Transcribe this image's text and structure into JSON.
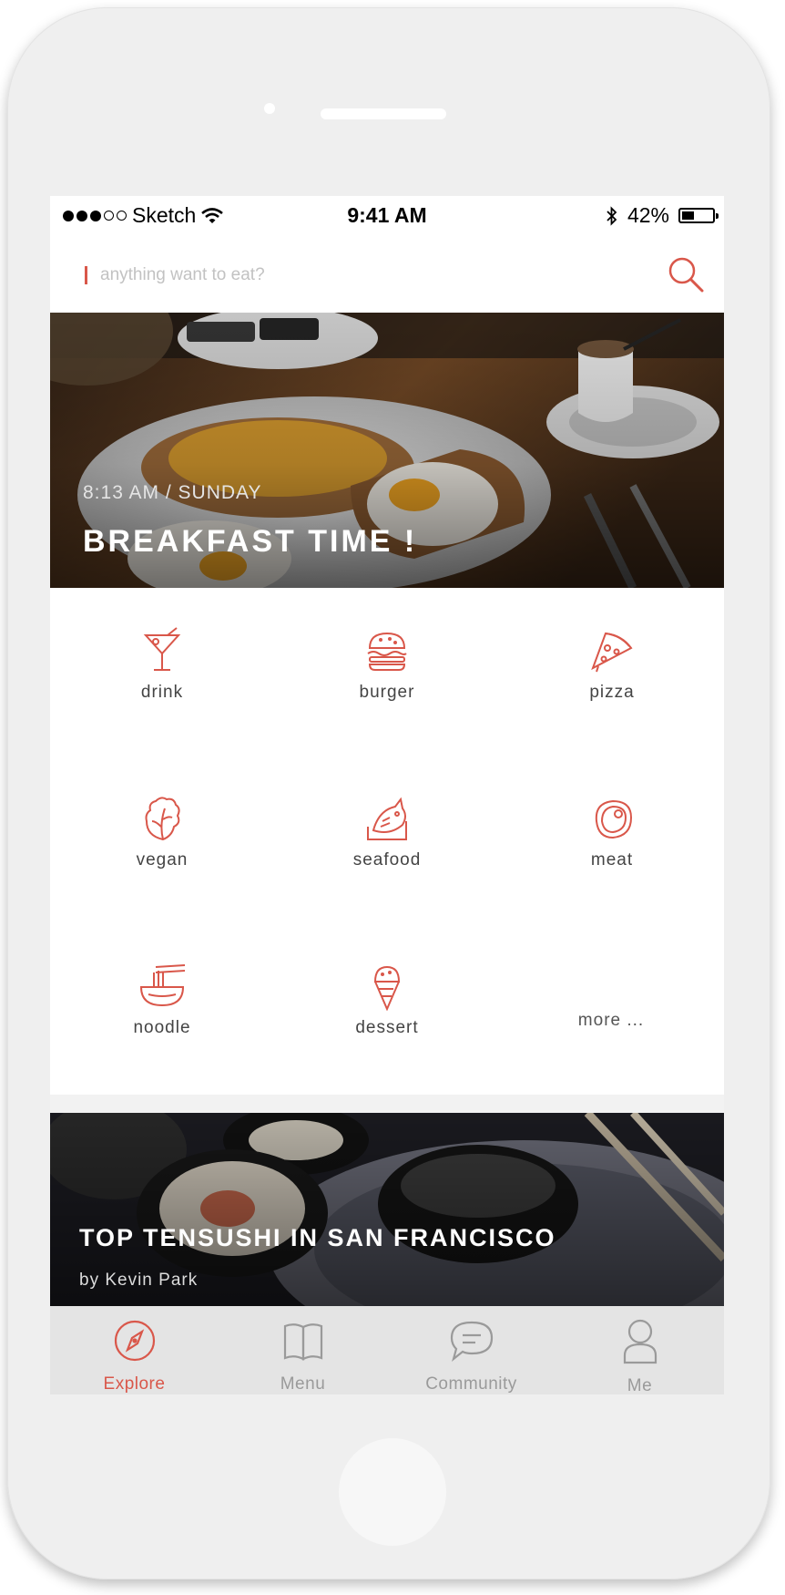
{
  "status_bar": {
    "carrier": "Sketch",
    "time": "9:41 AM",
    "battery_percent": "42%",
    "battery_level": 0.42,
    "signal_bars_filled": 3,
    "signal_bars_total": 5
  },
  "search": {
    "placeholder": "anything want to eat?",
    "icon": "search-icon"
  },
  "hero": {
    "subtitle": "8:13 AM / SUNDAY",
    "title": "BREAKFAST TIME !"
  },
  "categories": [
    {
      "label": "drink",
      "icon": "cocktail-icon"
    },
    {
      "label": "burger",
      "icon": "burger-icon"
    },
    {
      "label": "pizza",
      "icon": "pizza-icon"
    },
    {
      "label": "vegan",
      "icon": "lettuce-icon"
    },
    {
      "label": "seafood",
      "icon": "fish-icon"
    },
    {
      "label": "meat",
      "icon": "steak-icon"
    },
    {
      "label": "noodle",
      "icon": "noodle-bowl-icon"
    },
    {
      "label": "dessert",
      "icon": "ice-cream-icon"
    }
  ],
  "more_label": "more ...",
  "feature": {
    "title": "TOP TENSUSHI IN SAN FRANCISCO",
    "author": "by Kevin Park"
  },
  "tabs": [
    {
      "label": "Explore",
      "icon": "compass-icon",
      "active": true
    },
    {
      "label": "Menu",
      "icon": "book-icon",
      "active": false
    },
    {
      "label": "Community",
      "icon": "chat-bubble-icon",
      "active": false
    },
    {
      "label": "Me",
      "icon": "user-icon",
      "active": false
    }
  ],
  "colors": {
    "accent": "#d9574a",
    "tab_inactive": "#9a9a9a",
    "tab_bar_bg": "#e4e4e4"
  }
}
